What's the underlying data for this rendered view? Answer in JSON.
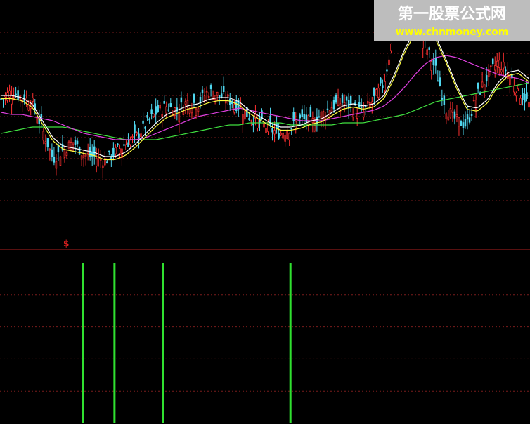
{
  "watermark": {
    "title": "第一股票公式网",
    "url": "www.chnmoney.com"
  },
  "signal_marker": "$",
  "colors": {
    "background": "#000000",
    "grid": "#7a1c1c",
    "separator": "#b02020",
    "candle_up": "#ff3030",
    "candle_down": "#50d8f0",
    "ma_short": "#ffffff",
    "ma_mid": "#ffff40",
    "ma_long": "#e040e0",
    "ma_longest": "#40e040",
    "signal_bar": "#30e030",
    "marker": "#e02020"
  },
  "chart_data": [
    {
      "type": "candlestick",
      "title": "",
      "grid": true,
      "ylim": [
        0,
        100
      ],
      "y_gridlines": [
        90,
        80,
        70,
        60,
        50,
        40,
        30,
        20,
        10
      ],
      "close_path": [
        58,
        62,
        59,
        57,
        44,
        30,
        34,
        38,
        32,
        31,
        29,
        33,
        37,
        40,
        46,
        52,
        55,
        53,
        57,
        56,
        62,
        60,
        58,
        55,
        50,
        47,
        44,
        42,
        45,
        49,
        47,
        51,
        55,
        57,
        54,
        52,
        58,
        66,
        92,
        100,
        95,
        84,
        72,
        54,
        48,
        46,
        60,
        69,
        76,
        71,
        62,
        56
      ],
      "ma_short_path": [
        60,
        60,
        59,
        56,
        48,
        40,
        36,
        35,
        34,
        33,
        31,
        31,
        33,
        37,
        42,
        47,
        51,
        53,
        55,
        56,
        58,
        59,
        59,
        57,
        53,
        50,
        47,
        45,
        45,
        46,
        48,
        49,
        52,
        55,
        56,
        55,
        56,
        60,
        70,
        82,
        91,
        93,
        88,
        77,
        65,
        55,
        54,
        58,
        66,
        71,
        72,
        68
      ],
      "ma_long_path": [
        52,
        51,
        51,
        50,
        49,
        48,
        46,
        44,
        42,
        41,
        40,
        39,
        39,
        39,
        40,
        42,
        44,
        46,
        48,
        50,
        51,
        52,
        53,
        54,
        53,
        52,
        51,
        50,
        49,
        48,
        48,
        48,
        49,
        50,
        51,
        52,
        53,
        55,
        59,
        64,
        70,
        75,
        78,
        79,
        78,
        76,
        74,
        72,
        70,
        69,
        68,
        66
      ],
      "ma_longest_path": [
        42,
        43,
        44,
        45,
        45,
        45,
        45,
        44,
        43,
        42,
        41,
        40,
        39,
        39,
        39,
        39,
        40,
        41,
        42,
        43,
        44,
        45,
        46,
        46,
        47,
        47,
        47,
        47,
        46,
        46,
        46,
        46,
        46,
        47,
        47,
        47,
        48,
        49,
        50,
        51,
        53,
        55,
        57,
        58,
        59,
        60,
        61,
        62,
        63,
        64,
        65,
        66
      ]
    },
    {
      "type": "bar",
      "title": "",
      "grid": true,
      "ylim": [
        0,
        1
      ],
      "values": [
        1,
        1,
        1,
        1
      ],
      "x_fraction": [
        0.157,
        0.216,
        0.308,
        0.548
      ]
    }
  ]
}
